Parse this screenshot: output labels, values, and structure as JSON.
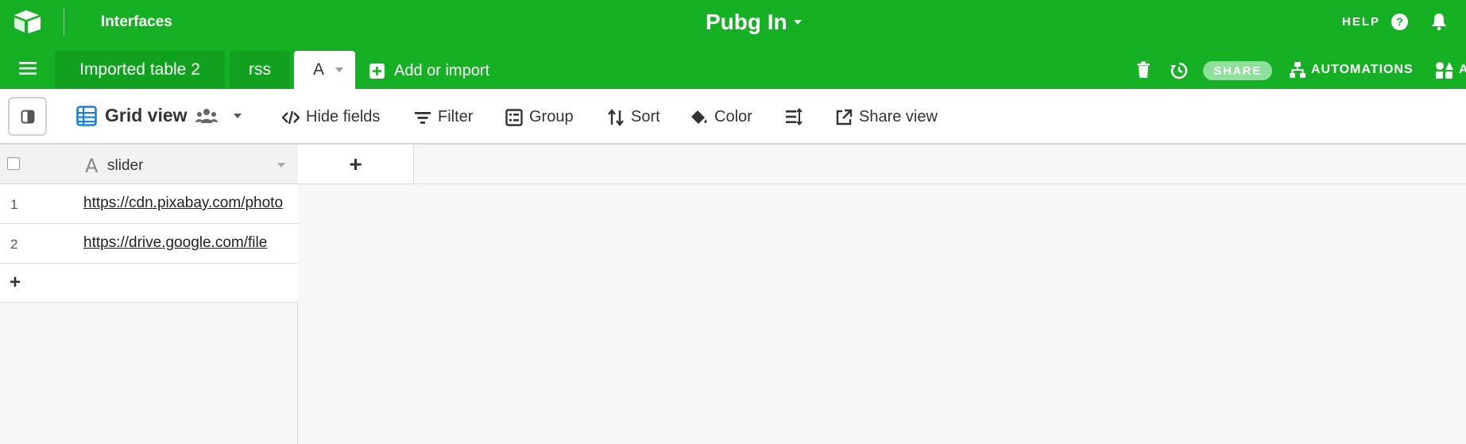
{
  "header": {
    "interfaces_label": "Interfaces",
    "base_title": "Pubg In",
    "help_label": "HELP",
    "bg_color": "#15b023"
  },
  "tabs": {
    "items": [
      {
        "label": "Imported table 2"
      },
      {
        "label": "rss"
      },
      {
        "label": "A"
      }
    ],
    "add_or_import": "Add or import",
    "share_label": "SHARE",
    "automations_label": "AUTOMATIONS",
    "apps_label": "A"
  },
  "toolbar": {
    "view_name": "Grid view",
    "hide_fields": "Hide fields",
    "filter": "Filter",
    "group": "Group",
    "sort": "Sort",
    "color": "Color",
    "share_view": "Share view"
  },
  "grid": {
    "field_type_icon": "A",
    "field_name": "slider",
    "add_column_label": "+",
    "add_row_label": "+",
    "rows": [
      {
        "num": "1",
        "value": "https://cdn.pixabay.com/photo"
      },
      {
        "num": "2",
        "value": "https://drive.google.com/file"
      }
    ]
  }
}
